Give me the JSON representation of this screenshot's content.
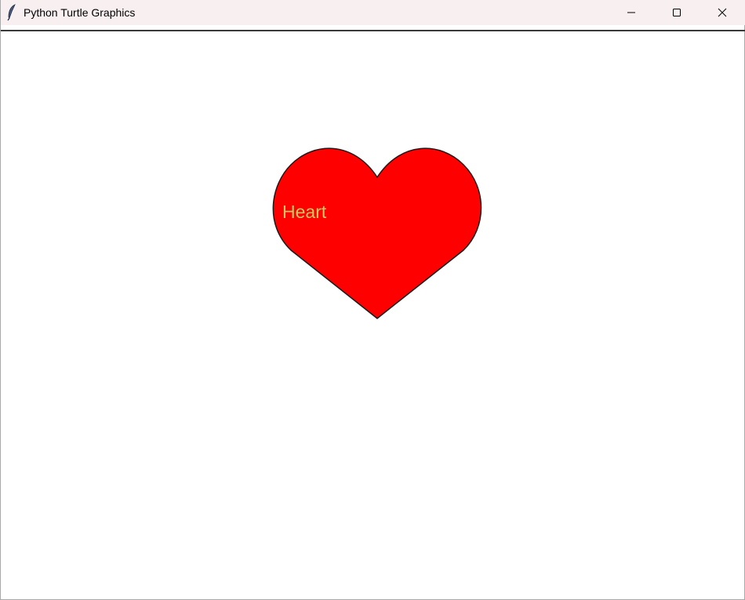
{
  "window": {
    "title": "Python Turtle Graphics",
    "app_icon": "feather-icon",
    "controls": [
      "minimize-icon",
      "maximize-icon",
      "close-icon"
    ]
  },
  "canvas": {
    "background": "#ffffff",
    "shape": {
      "name": "heart",
      "fill_color": "#ff0000",
      "outline_color": "#1a1a1a"
    },
    "label": {
      "text": "Heart",
      "color": "#c8c864"
    }
  }
}
